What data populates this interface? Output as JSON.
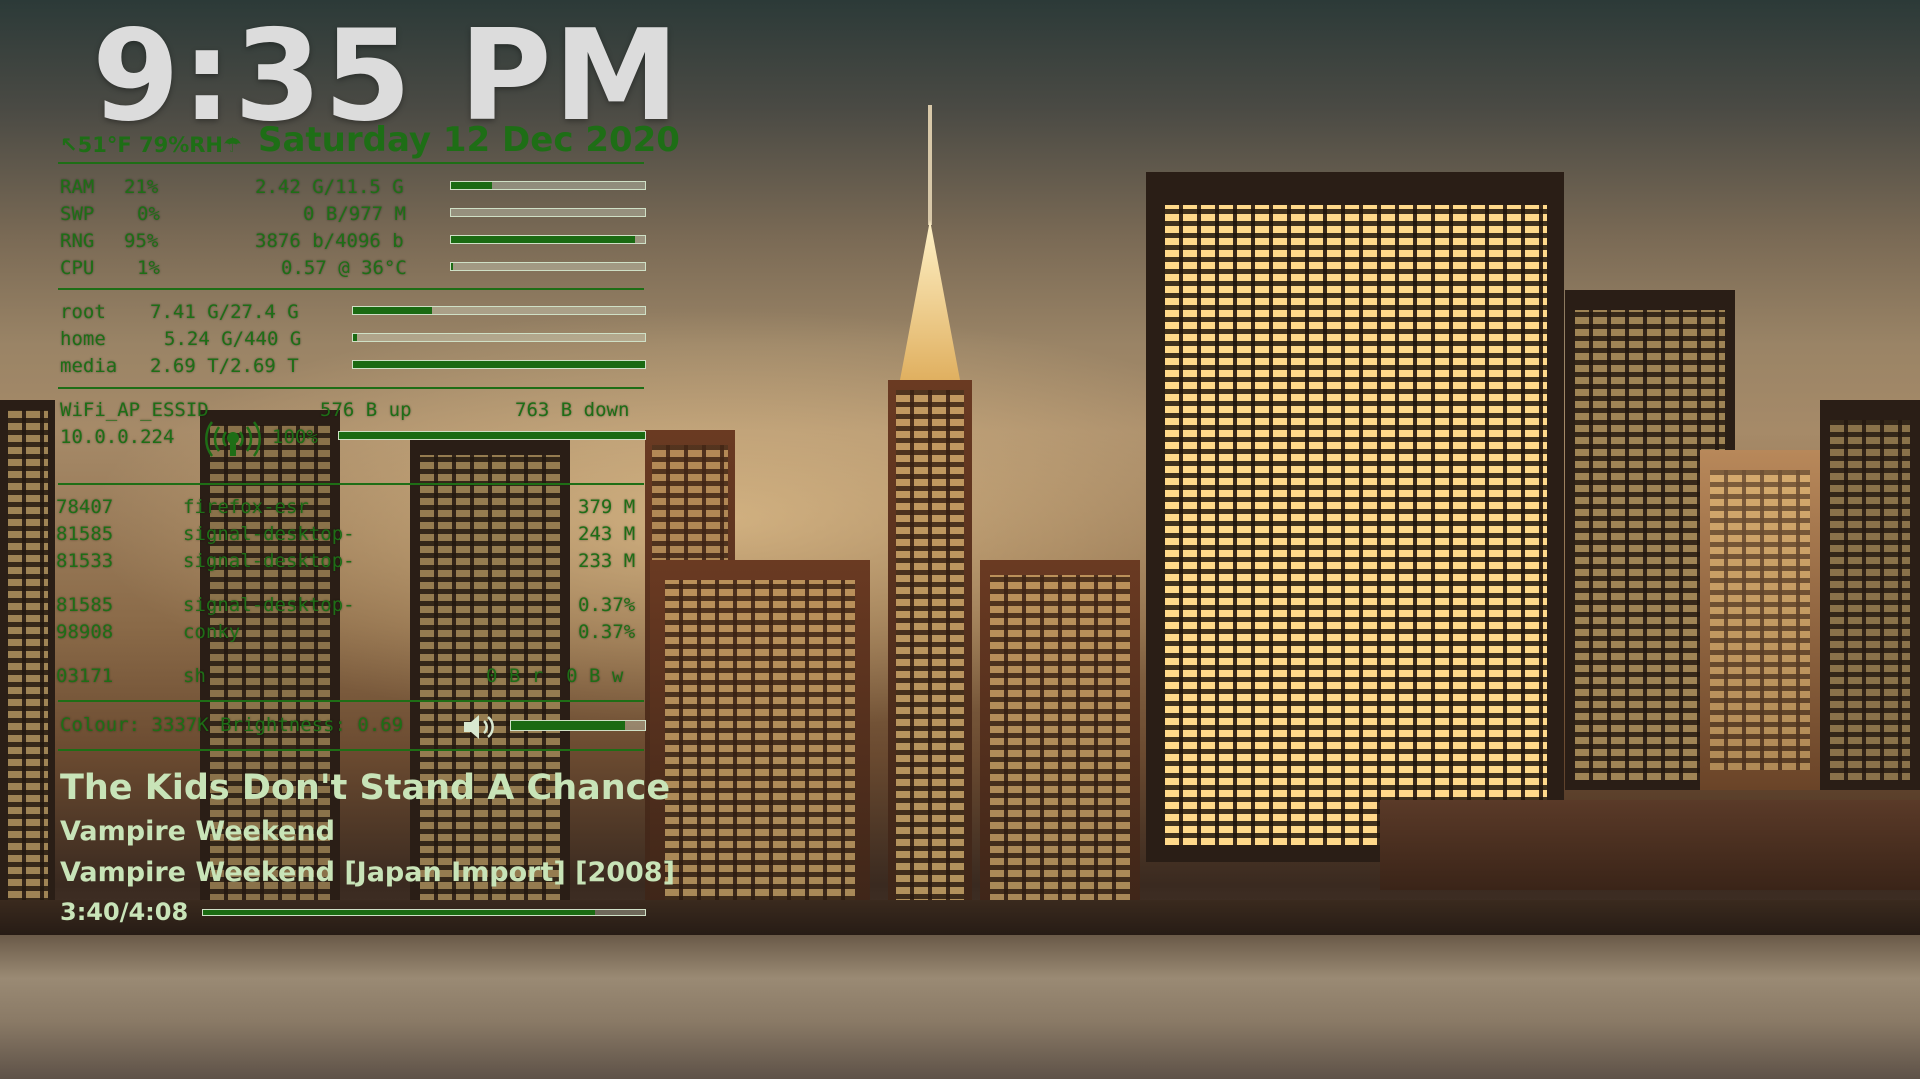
{
  "clock": {
    "time": "9:35 PM",
    "date": "Saturday 12 Dec 2020",
    "weather": "↖51°F 79%RH☂"
  },
  "system": [
    {
      "label": "RAM",
      "percent": "21%",
      "detail": "2.42 G/11.5 G",
      "fill": 0.21
    },
    {
      "label": "SWP",
      "percent": "0%",
      "detail": "0 B/977 M",
      "fill": 0.0
    },
    {
      "label": "RNG",
      "percent": "95%",
      "detail": "3876 b/4096 b",
      "fill": 0.95
    },
    {
      "label": "CPU",
      "percent": "1%",
      "detail": "0.57 @ 36°C",
      "fill": 0.01
    }
  ],
  "disks": [
    {
      "label": "root",
      "detail": "7.41 G/27.4 G",
      "fill": 0.27
    },
    {
      "label": "home",
      "detail": "5.24 G/440 G",
      "fill": 0.012
    },
    {
      "label": "media",
      "detail": "2.69 T/2.69 T",
      "fill": 1.0
    }
  ],
  "network": {
    "ssid": "WiFi_AP_ESSID",
    "up": "576 B up",
    "down": "763 B down",
    "ip": "10.0.0.224",
    "signal": "100%",
    "signal_fill": 1.0
  },
  "processes_mem": [
    {
      "pid": "78407",
      "name": "firefox-esr",
      "value": "379 M"
    },
    {
      "pid": "81585",
      "name": "signal-desktop-",
      "value": "243 M"
    },
    {
      "pid": "81533",
      "name": "signal-desktop-",
      "value": "233 M"
    }
  ],
  "processes_cpu": [
    {
      "pid": "81585",
      "name": "signal-desktop-",
      "value": "0.37%"
    },
    {
      "pid": "98908",
      "name": "conky",
      "value": "0.37%"
    }
  ],
  "processes_io": [
    {
      "pid": "03171",
      "name": "sh",
      "value": "0 B r  0 B w"
    }
  ],
  "display": {
    "text": "Colour: 3337K Brightness: 0.69",
    "volume_fill": 0.85
  },
  "music": {
    "title": "The Kids Don't Stand A Chance",
    "artist": "Vampire Weekend",
    "album": "Vampire Weekend [Japan Import] [2008]",
    "position": "3:40/4:08",
    "progress": 0.887
  },
  "colors": {
    "accent": "#1e6e16",
    "clock": "#dcdcdc",
    "song": "#c8e4b8"
  }
}
